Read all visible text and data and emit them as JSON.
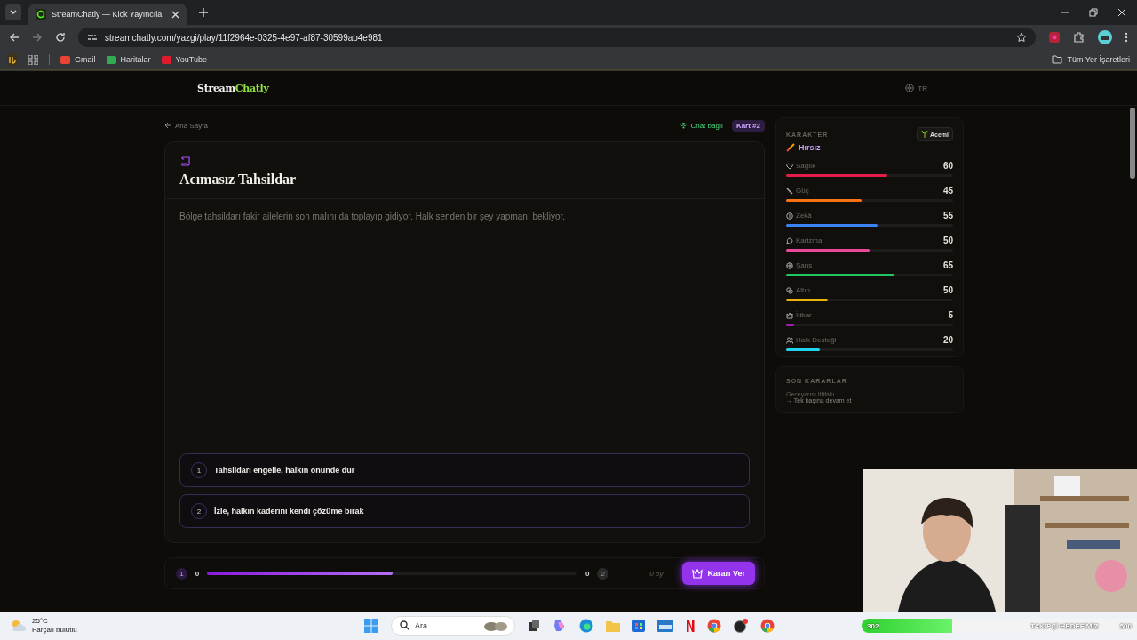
{
  "browser": {
    "tab_title": "StreamChatly — Kick Yayıncıla",
    "url": "streamchatly.com/yazgi/play/11f2964e-0325-4e97-af87-30599ab4e981",
    "bookmarks": [
      "Gmail",
      "Haritalar",
      "YouTube"
    ],
    "all_bookmarks": "Tüm Yer İşaretleri"
  },
  "header": {
    "logo_first": "Stream",
    "logo_second": "Chatly",
    "language": "TR"
  },
  "top": {
    "back_link": "Ana Sayfa",
    "chat_status": "Chat bağlı",
    "card_badge": "Kart #2"
  },
  "card": {
    "title": "Acımasız Tahsildar",
    "description": "Bölge tahsildarı fakir ailelerin son malını da toplayıp gidiyor. Halk senden bir şey yapmanı bekliyor.",
    "options": [
      {
        "number": "1",
        "text": "Tahsildarı engelle, halkın önünde dur"
      },
      {
        "number": "2",
        "text": "İzle, halkın kaderini kendi çözüme bırak"
      }
    ]
  },
  "vote": {
    "left_number": "1",
    "left_count": "0",
    "level": 0.5,
    "right_count": "0",
    "right_number": "2",
    "total": "0 oy",
    "button": "Kararı Ver"
  },
  "character": {
    "heading": "KARAKTER",
    "rank": "Acemi",
    "class_name": "Hırsız",
    "stats": [
      {
        "name": "Sağlık",
        "value": "60",
        "level": 0.6,
        "color": "#e11d48"
      },
      {
        "name": "Güç",
        "value": "45",
        "level": 0.45,
        "color": "#f97316"
      },
      {
        "name": "Zekâ",
        "value": "55",
        "level": 0.55,
        "color": "#3b82f6"
      },
      {
        "name": "Karizma",
        "value": "50",
        "level": 0.5,
        "color": "#ec4899"
      },
      {
        "name": "Şans",
        "value": "65",
        "level": 0.65,
        "color": "#22c55e"
      },
      {
        "name": "Altın",
        "value": "50",
        "level": 0.25,
        "color": "#eab308"
      },
      {
        "name": "İtibar",
        "value": "5",
        "level": 0.05,
        "color": "#a21caf"
      },
      {
        "name": "Halk Desteği",
        "value": "20",
        "level": 0.2,
        "color": "#22d3ee"
      }
    ]
  },
  "recent": {
    "heading": "SON KARARLAR",
    "items": [
      {
        "title": "Geceyarısı İttifakı",
        "choice": "→ Tek başına devam et"
      }
    ]
  },
  "taskbar": {
    "temperature": "25°C",
    "weather": "Parçalı bulutlu",
    "search_placeholder": "Ara"
  },
  "follower_goal": {
    "current": "302",
    "label": "TAKİPÇİ HEDEFİMİZ",
    "target": "500",
    "level": 0.33
  }
}
